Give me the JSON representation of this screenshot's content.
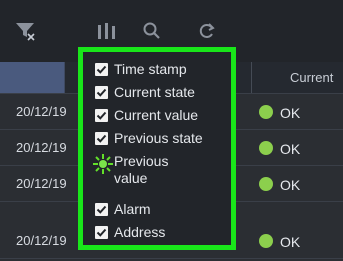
{
  "toolbar": {
    "icons": [
      "filter-clear-icon",
      "columns-icon",
      "search-icon",
      "refresh-icon"
    ]
  },
  "table": {
    "header_current": "Current",
    "rows": [
      {
        "date": "20/12/19",
        "status": "OK",
        "status_color": "#8ccf4d"
      },
      {
        "date": "20/12/19",
        "status": "OK",
        "status_color": "#8ccf4d"
      },
      {
        "date": "20/12/19",
        "status": "OK",
        "status_color": "#8ccf4d"
      },
      {
        "date": "20/12/19",
        "status": "OK",
        "status_color": "#8ccf4d"
      }
    ]
  },
  "column_menu": {
    "highlight_color": "#19e61a",
    "items": [
      {
        "label": "Time stamp",
        "checked": true
      },
      {
        "label": "Current state",
        "checked": true
      },
      {
        "label": "Current value",
        "checked": true
      },
      {
        "label": "Previous state",
        "checked": true
      },
      {
        "label": "Previous value",
        "checked": false,
        "hovered": true
      },
      {
        "label": "Alarm",
        "checked": true
      },
      {
        "label": "Address",
        "checked": true
      }
    ]
  }
}
